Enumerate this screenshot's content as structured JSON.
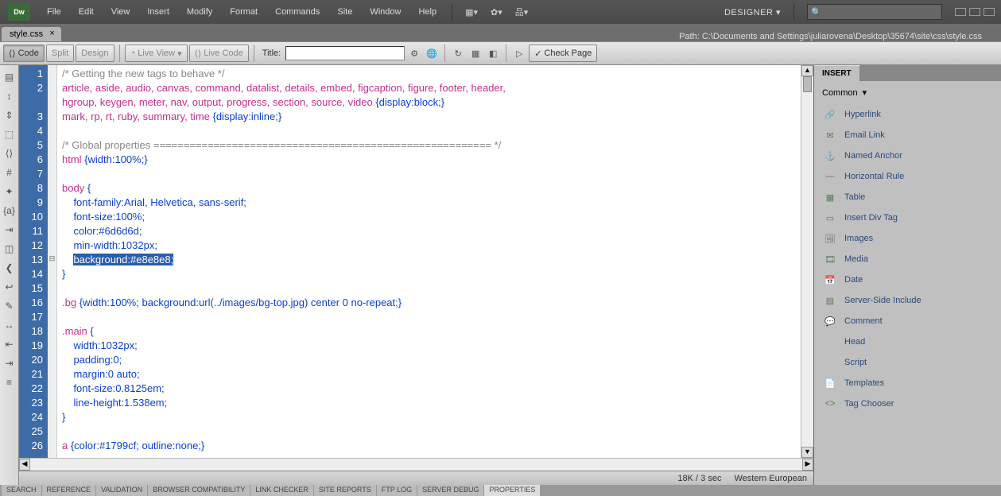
{
  "menu": [
    "File",
    "Edit",
    "View",
    "Insert",
    "Modify",
    "Format",
    "Commands",
    "Site",
    "Window",
    "Help"
  ],
  "layout": "DESIGNER",
  "tab": {
    "name": "style.css",
    "path": "Path:  C:\\Documents and Settings\\juliarovena\\Desktop\\35674\\site\\css\\style.css"
  },
  "toolbar": {
    "code": "Code",
    "split": "Split",
    "design": "Design",
    "liveview": "Live View",
    "livecode": "Live Code",
    "title_lbl": "Title:",
    "check": "Check Page"
  },
  "insert": {
    "tab": "INSERT",
    "category": "Common",
    "items": [
      "Hyperlink",
      "Email Link",
      "Named Anchor",
      "Horizontal Rule",
      "Table",
      "Insert Div Tag",
      "Images",
      "Media",
      "Date",
      "Server-Side Include",
      "Comment",
      "Head",
      "Script",
      "Templates",
      "Tag Chooser"
    ]
  },
  "code": [
    {
      "n": 1,
      "t": "comment",
      "text": "/* Getting the new tags to behave */"
    },
    {
      "n": 2,
      "t": "css",
      "sel": "article, aside, audio, canvas, command, datalist, details, embed, figcaption, figure, footer, header,"
    },
    {
      "n": 0,
      "t": "css2",
      "sel": "hgroup, keygen, meter, nav, output, progress, section, source, video ",
      "decl": "{display:block;}"
    },
    {
      "n": 3,
      "t": "css",
      "sel": "mark, rp, rt, ruby, summary, time ",
      "decl": "{display:inline;}"
    },
    {
      "n": 4,
      "t": "blank"
    },
    {
      "n": 5,
      "t": "comment",
      "text": "/* Global properties ======================================================== */"
    },
    {
      "n": 6,
      "t": "css",
      "sel": "html ",
      "decl": "{width:100%;}"
    },
    {
      "n": 7,
      "t": "blank"
    },
    {
      "n": 8,
      "t": "css",
      "sel": "body ",
      "decl": "{"
    },
    {
      "n": 9,
      "t": "prop",
      "p": "    font-family:",
      "v": "Arial, Helvetica, sans-serif;"
    },
    {
      "n": 10,
      "t": "prop",
      "p": "    font-size:",
      "v": "100%;"
    },
    {
      "n": 11,
      "t": "prop",
      "p": "    color:",
      "v": "#6d6d6d;"
    },
    {
      "n": 12,
      "t": "prop",
      "p": "    min-width:",
      "v": "1032px;"
    },
    {
      "n": 13,
      "t": "propsel",
      "p": "    ",
      "selp": "background:",
      "selv": "#e8e8e8;"
    },
    {
      "n": 14,
      "t": "brace",
      "text": "}"
    },
    {
      "n": 15,
      "t": "blank"
    },
    {
      "n": 16,
      "t": "css",
      "sel": ".bg ",
      "decl": "{width:100%; background:url(../images/bg-top.jpg) center 0 no-repeat;}"
    },
    {
      "n": 17,
      "t": "blank"
    },
    {
      "n": 18,
      "t": "css",
      "sel": ".main ",
      "decl": "{"
    },
    {
      "n": 19,
      "t": "prop",
      "p": "    width:",
      "v": "1032px;"
    },
    {
      "n": 20,
      "t": "prop",
      "p": "    padding:",
      "v": "0;"
    },
    {
      "n": 21,
      "t": "prop",
      "p": "    margin:",
      "v": "0 auto;"
    },
    {
      "n": 22,
      "t": "prop",
      "p": "    font-size:",
      "v": "0.8125em;"
    },
    {
      "n": 23,
      "t": "prop",
      "p": "    line-height:",
      "v": "1.538em;"
    },
    {
      "n": 24,
      "t": "brace",
      "text": "}"
    },
    {
      "n": 25,
      "t": "blank"
    },
    {
      "n": 26,
      "t": "css",
      "sel": "a ",
      "decl": "{color:#1799cf; outline:none;}"
    }
  ],
  "status": {
    "size": "18K / 3 sec",
    "enc": "Western European"
  },
  "bottom_tabs": [
    "SEARCH",
    "REFERENCE",
    "VALIDATION",
    "BROWSER COMPATIBILITY",
    "LINK CHECKER",
    "SITE REPORTS",
    "FTP LOG",
    "SERVER DEBUG",
    "PROPERTIES"
  ]
}
